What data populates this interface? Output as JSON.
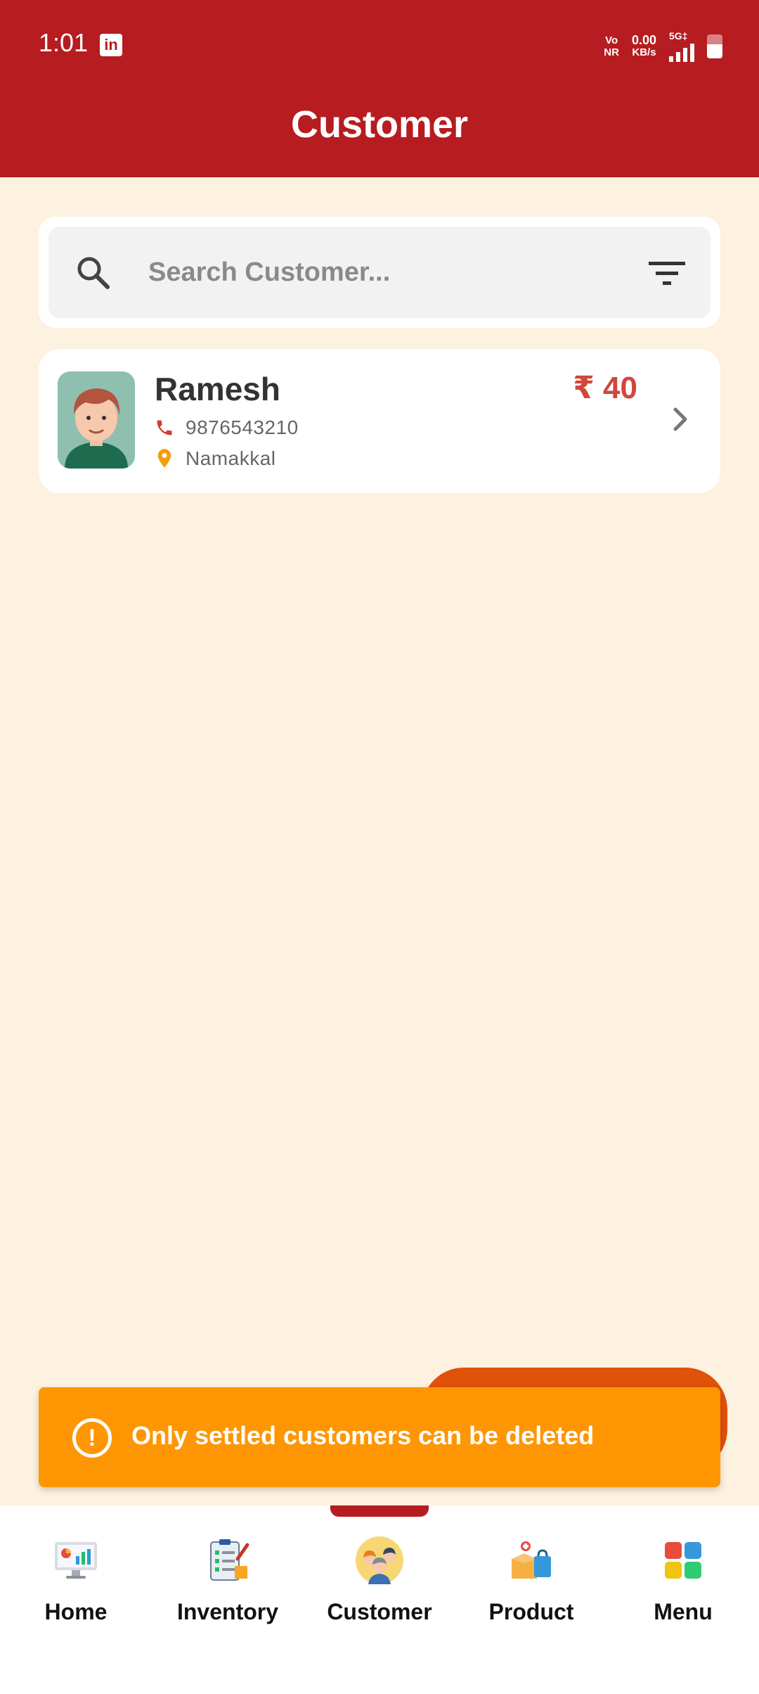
{
  "status_bar": {
    "time": "1:01",
    "app_notification_icon": "linkedin-icon",
    "volte_top": "Vo",
    "volte_bottom": "NR",
    "speed_value": "0.00",
    "speed_unit": "KB/s",
    "network": "5G‡"
  },
  "header": {
    "title": "Customer",
    "color": "#b61c20"
  },
  "search": {
    "placeholder": "Search Customer...",
    "icon": "search-icon",
    "filter_icon": "filter-icon"
  },
  "customers": [
    {
      "name": "Ramesh",
      "amount": "₹ 40",
      "phone": "9876543210",
      "location": "Namakkal"
    }
  ],
  "snackbar": {
    "message": "Only settled customers can be deleted",
    "color": "#fe9603"
  },
  "nav": {
    "items": [
      {
        "label": "Home",
        "icon": "home-dashboard-icon"
      },
      {
        "label": "Inventory",
        "icon": "inventory-checklist-icon"
      },
      {
        "label": "Customer",
        "icon": "customer-group-icon",
        "active": true
      },
      {
        "label": "Product",
        "icon": "product-box-icon"
      },
      {
        "label": "Menu",
        "icon": "menu-grid-icon"
      }
    ]
  }
}
